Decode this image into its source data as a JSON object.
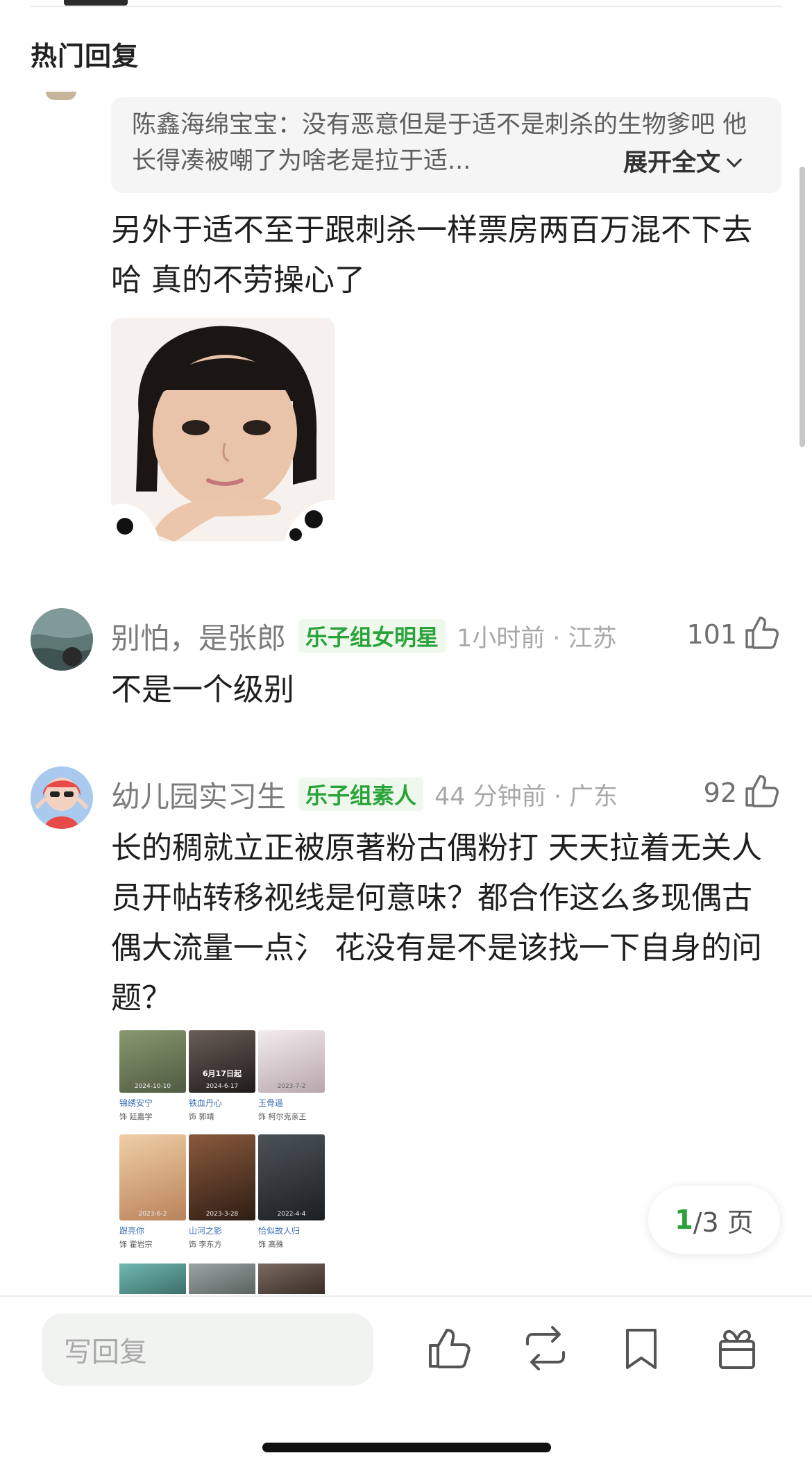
{
  "header": {
    "section_title": "热门回复"
  },
  "thread": {
    "quoted_reply": {
      "author": "陈鑫海绵宝宝：",
      "text": "没有恶意但是于适不是刺杀的生物爹吧 他长得凑被嘲了为啥老是拉于适...",
      "expand_label": "展开全文"
    },
    "reply_text": "另外于适不至于跟刺杀一样票房两百万混不下去哈 真的不劳操心了",
    "image_icon": "child-face-photo"
  },
  "comments": [
    {
      "username": "别怕，是张郎",
      "badge": "乐子组女明星",
      "time": "1小时前",
      "location": "江苏",
      "time_location": "1小时前 · 江苏",
      "likes": "101",
      "text": "不是一个级别",
      "avatar_icon": "water-avatar"
    },
    {
      "username": "幼儿园实习生",
      "badge": "乐子组素人",
      "time": "44 分钟前",
      "location": "广东",
      "time_location": "44 分钟前 · 广东",
      "likes": "92",
      "text": "长的稠就立正被原著粉古偶粉打 天天拉着无关人员开帖转移视线是何意味？都合作这么多现偶古偶大流量一点氵 花没有是不是该找一下自身的问题？",
      "avatar_icon": "cartoon-girl-avatar"
    }
  ],
  "film_grid": {
    "films": [
      {
        "title": "锦绣安宁",
        "actor": "饰 延嘉学",
        "date": "2024-10-10",
        "color": "#6b7a5a"
      },
      {
        "title": "铁血丹心",
        "actor": "饰 郭靖",
        "date": "2024-6-17",
        "color": "#3f3a38",
        "overlay": "6月17日起"
      },
      {
        "title": "玉骨遥",
        "actor": "饰 柯尔克亲王",
        "date": "2023-7-2",
        "color": "#d9d2d6"
      },
      {
        "title": "跟亮你",
        "actor": "饰 霍岩宗",
        "date": "2023-6-2",
        "color": "#e1b48a"
      },
      {
        "title": "山河之影",
        "actor": "饰 李东方",
        "date": "2023-3-28",
        "color": "#5a3b2a"
      },
      {
        "title": "恰似故人归",
        "actor": "饰 高殊",
        "date": "2022-4-4",
        "color": "#2e3438"
      }
    ]
  },
  "pagination": {
    "current": "1",
    "total": "/3 页"
  },
  "bottom_bar": {
    "reply_placeholder": "写回复",
    "icons": [
      "like-icon",
      "repost-icon",
      "bookmark-icon",
      "gift-icon"
    ]
  }
}
